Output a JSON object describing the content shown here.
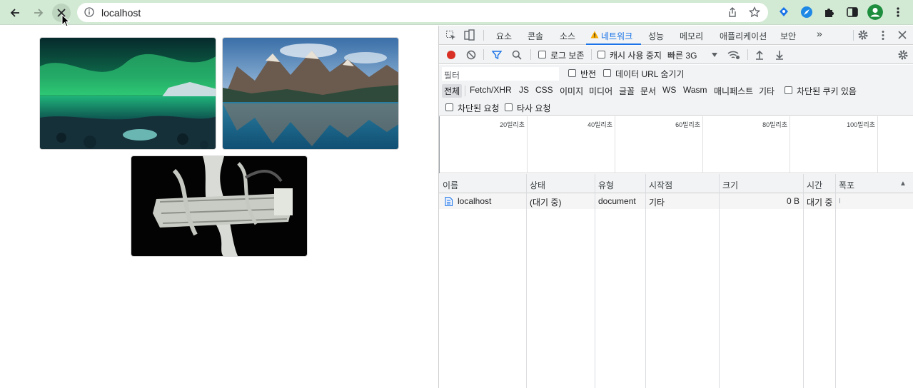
{
  "browser": {
    "url": "localhost"
  },
  "devtools": {
    "tabs": [
      "요소",
      "콘솔",
      "소스",
      "네트워크",
      "성능",
      "메모리",
      "애플리케이션",
      "보안"
    ],
    "selected_tab": "네트워크",
    "more_tabs": "»",
    "toolbar": {
      "preserve_log": "로그 보존",
      "disable_cache": "캐시 사용 중지",
      "throttling": "빠른 3G"
    },
    "filter": {
      "placeholder": "필터",
      "invert": "반전",
      "hide_data_urls": "데이터 URL 숨기기",
      "types": [
        "전체",
        "Fetch/XHR",
        "JS",
        "CSS",
        "이미지",
        "미디어",
        "글꼴",
        "문서",
        "WS",
        "Wasm",
        "매니페스트",
        "기타"
      ],
      "selected_type": "전체",
      "blocked_cookies": "차단된 쿠키 있음",
      "blocked_requests": "차단된 요청",
      "third_party": "타사 요청"
    },
    "timeline": {
      "ticks": [
        "20밀리초",
        "40밀리초",
        "60밀리초",
        "80밀리초",
        "100밀리초"
      ]
    },
    "table": {
      "columns": [
        "이름",
        "상태",
        "유형",
        "시작점",
        "크기",
        "시간",
        "폭포"
      ],
      "sort_indicator": "▲",
      "rows": [
        {
          "name": "localhost",
          "status": "(대기 중)",
          "type": "document",
          "initiator": "기타",
          "size": "0 B",
          "time": "대기 중"
        }
      ]
    }
  }
}
